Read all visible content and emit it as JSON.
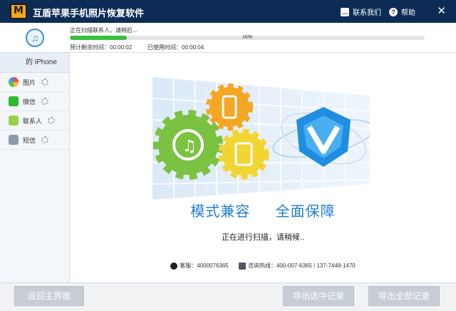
{
  "app": {
    "title": "互盾苹果手机照片恢复软件"
  },
  "titlebar": {
    "contact_label": "联系我们",
    "help_label": "帮助",
    "close_glyph": "✕"
  },
  "scan": {
    "status_text": "正在扫描联系人，请稍后...",
    "progress_percent": 16,
    "progress_label": "16%",
    "time_left": "预计剩余时间：00:00:02",
    "time_used": "已使用时间：00:00:04"
  },
  "sidebar": {
    "device_name": "的 iPhone",
    "items": [
      {
        "label": "图片",
        "icon": "photos-icon"
      },
      {
        "label": "微信",
        "icon": "wechat-icon"
      },
      {
        "label": "联系人",
        "icon": "contacts-icon"
      },
      {
        "label": "短信",
        "icon": "sms-icon"
      }
    ]
  },
  "main": {
    "slogan_left": "模式兼容",
    "slogan_right": "全面保障",
    "scan_status": "正在进行扫描，请稍候..",
    "qq_label": "客服：4000076365",
    "hotline_label": "咨询热线：400-007-6365 / 137-7448-1470"
  },
  "footer": {
    "back_label": "返回主界面",
    "export_selected_label": "导出选中记录",
    "export_all_label": "导出全部记录"
  },
  "colors": {
    "titlebar": "#0c2c55",
    "accent": "#1f7fcf",
    "progress": "#3cbf3c",
    "button_disabled": "#c6cdd5"
  }
}
